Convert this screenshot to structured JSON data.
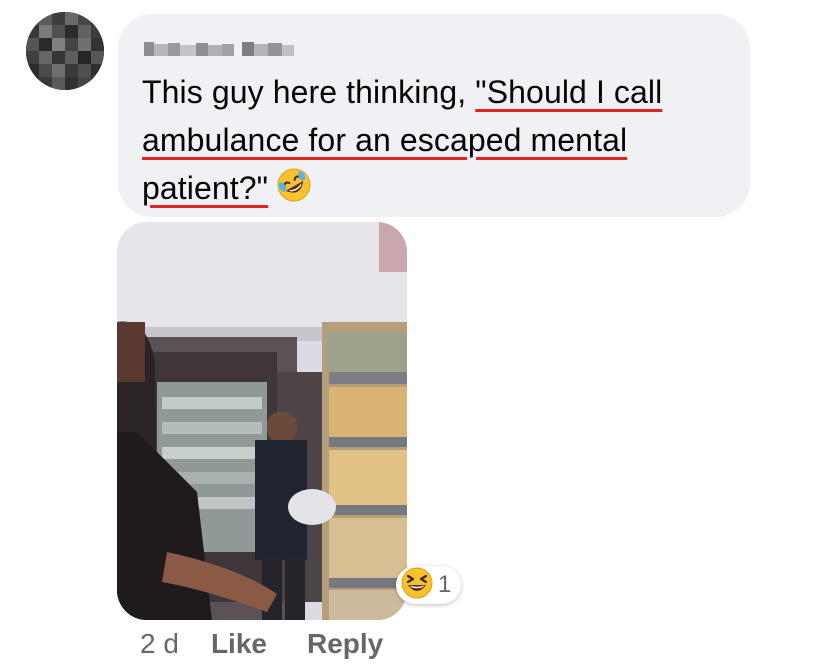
{
  "comment": {
    "author_icon": "blurred-author-name",
    "avatar_icon": "blurred-avatar",
    "lines": [
      {
        "plain": "This guy here thinking, ",
        "underlined": "\"Should I call"
      },
      {
        "plain": "",
        "underlined": "ambulance for an escaped mental"
      },
      {
        "plain": "",
        "underlined": "patient?\"",
        "trailing_emoji": "rolling-on-floor-laughing-emoji"
      }
    ],
    "underline_color": "#e02424",
    "bubble_color": "#f0f1f4"
  },
  "attachment": {
    "image_icon": "video-thumbnail-store-aisle"
  },
  "reaction": {
    "emoji_icon": "laughing-squinting-emoji",
    "count": "1"
  },
  "actions": {
    "time": "2 d",
    "like_label": "Like",
    "reply_label": "Reply",
    "text_color": "#65676b"
  }
}
